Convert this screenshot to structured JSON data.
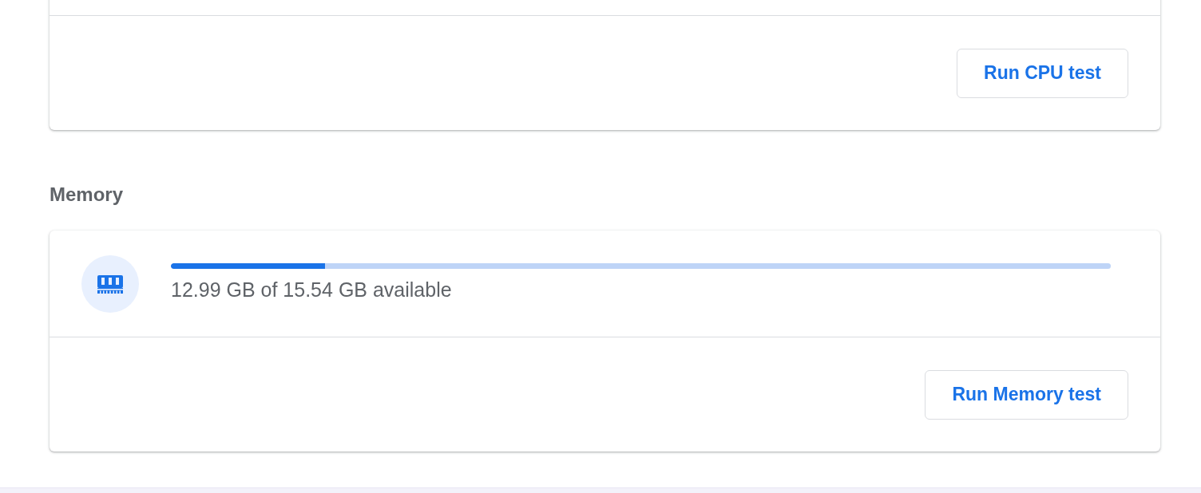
{
  "cpu_card": {
    "button": "Run CPU test"
  },
  "memory": {
    "heading": "Memory",
    "usage": {
      "level": 0.164,
      "text": "12.99 GB of 15.54 GB available"
    },
    "button": "Run Memory test"
  }
}
